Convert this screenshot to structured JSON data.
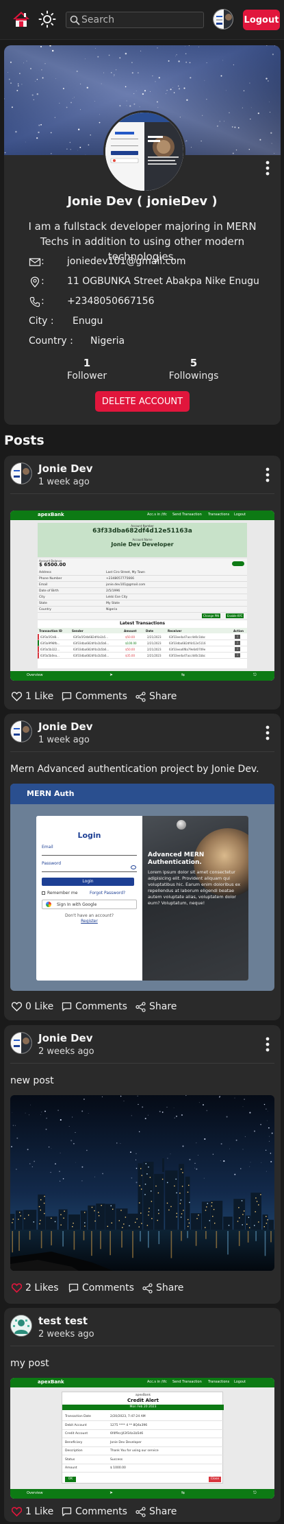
{
  "nav": {
    "search_placeholder": "Search",
    "logout_label": "Logout"
  },
  "profile": {
    "display_name": "Jonie Dev ( jonieDev )",
    "bio": "I am a fullstack developer majoring in MERN Techs in addition to using other modern technologies.",
    "colon": ":",
    "email": "joniedev101@gmail.com",
    "address": "11 OGBUNKA Street Abakpa Nike Enugu",
    "phone": "+2348050667156",
    "city_label": "City :",
    "city": "Enugu",
    "country_label": "Country :",
    "country": "Nigeria",
    "followers_count": "1",
    "followers_label": "Follower",
    "followings_count": "5",
    "followings_label": "Followings",
    "delete_label": "DELETE ACCOUNT"
  },
  "posts_heading": "Posts",
  "posts": [
    {
      "author": "Jonie Dev",
      "time": "1 week ago",
      "text": "",
      "likes": "1 Like",
      "liked": false,
      "comments": "Comments",
      "share": "Share",
      "image": {
        "brand": "apexBank",
        "nav": [
          "Acc.s in /tfc",
          "Send Transaction",
          "Transactions",
          "Logout"
        ],
        "account_number_label": "Account Number",
        "account_number": "63f33dba682df4d12e51163a",
        "account_name_label": "Account Name",
        "account_name": "Jonie Dev Developer",
        "balance_label": "Account Balance",
        "balance": "$ 6500.00",
        "details": [
          [
            "Address",
            "Last Ciro Street, My Town"
          ],
          [
            "Phone Number",
            "+2348057775666"
          ],
          [
            "Email",
            "jonie.dev101@gmail.com"
          ],
          [
            "Date of Birth",
            "2/5/1996"
          ],
          [
            "City",
            "Lekki Ese City"
          ],
          [
            "State",
            "My State"
          ],
          [
            "Country",
            "Nigeria"
          ]
        ],
        "buttons": [
          "Change PIN",
          "Enable KYC"
        ],
        "table_title": "Latest Transactions",
        "table_headers": [
          "Transaction ID",
          "Sender",
          "Amount",
          "Date",
          "Receiver",
          "Action"
        ],
        "table_rows": [
          [
            "63f3a5f2d8...",
            "63f3a5f2db682df4a1b5...",
            "$50.00",
            "2/21/2023",
            "63f33ee4a47acc4d0c1bbc",
            "i"
          ],
          [
            "63f3a9f98fb...",
            "63f33dba682df4a1b5b6...",
            "$100.00",
            "2/21/2023",
            "63f33dba682df4d12e5116",
            "i"
          ],
          [
            "63f3a5b322...",
            "63f33dba682df4a1b5b6...",
            "$50.00",
            "2/21/2023",
            "63f33eea6f8a79e6d0709e",
            "i"
          ],
          [
            "63f3a5b0ea...",
            "63f33dba682df4a1b5b6...",
            "$35.00",
            "2/21/2023",
            "63f33ee4a47acc4d0c1bbc",
            "i"
          ]
        ],
        "footer": [
          "Overview"
        ]
      }
    },
    {
      "author": "Jonie Dev",
      "time": "1 week ago",
      "text": "Mern Advanced authentication project by Jonie Dev.",
      "likes": "0 Like",
      "liked": false,
      "comments": "Comments",
      "share": "Share",
      "image": {
        "brand": "MERN Auth",
        "login_title": "Login",
        "email_label": "Email",
        "password_label": "Password",
        "login_button": "Login",
        "remember": "Remember me",
        "forgot": "Forgot Password?",
        "google": "Sign In with Google",
        "no_account": "Don't have an account?",
        "register": "Register",
        "panel_title": "Advanced MERN Authentication.",
        "panel_text": "Lorem ipsum dolor sit amet consectetur adipisicing elit. Provident aliquam qui voluptatibus hic. Earum enim doloribus ex repellendus at laborum eligendi beatae autem voluptate alias, voluptatem dolor eum? Voluptatum, neque!"
      }
    },
    {
      "author": "Jonie Dev",
      "time": "2 weeks ago",
      "text": "new post",
      "likes": "2 Likes",
      "liked": true,
      "comments": "Comments",
      "share": "Share"
    },
    {
      "author": "test test",
      "time": "2 weeks ago",
      "text": "my post",
      "likes": "1 Like",
      "liked": true,
      "comments": "Comments",
      "share": "Share",
      "image": {
        "brand": "apexBank",
        "nav": [
          "Acc.s in /tfc",
          "Send Transaction",
          "Transactions",
          "Logout"
        ],
        "brand_small": "apexBank",
        "alert_title": "Credit Alert",
        "alert_date": "Mon Feb 20 2023",
        "rows": [
          [
            "Transaction Date",
            "2/20/2023, 7:47:24 AM"
          ],
          [
            "Debit Account",
            "1275 **** 4 ** 8Q4a396"
          ],
          [
            "Credit Account",
            "6f4f9ccJ43f34a1b5d6"
          ],
          [
            "Beneficiary",
            "Jonie Dev Developer"
          ],
          [
            "Description",
            "Thank You for using our service"
          ],
          [
            "Status",
            "Success"
          ],
          [
            "Amount",
            "$ 1000.00"
          ]
        ],
        "ok": "OK",
        "close": "Close",
        "footer": [
          "Overview"
        ]
      }
    }
  ]
}
